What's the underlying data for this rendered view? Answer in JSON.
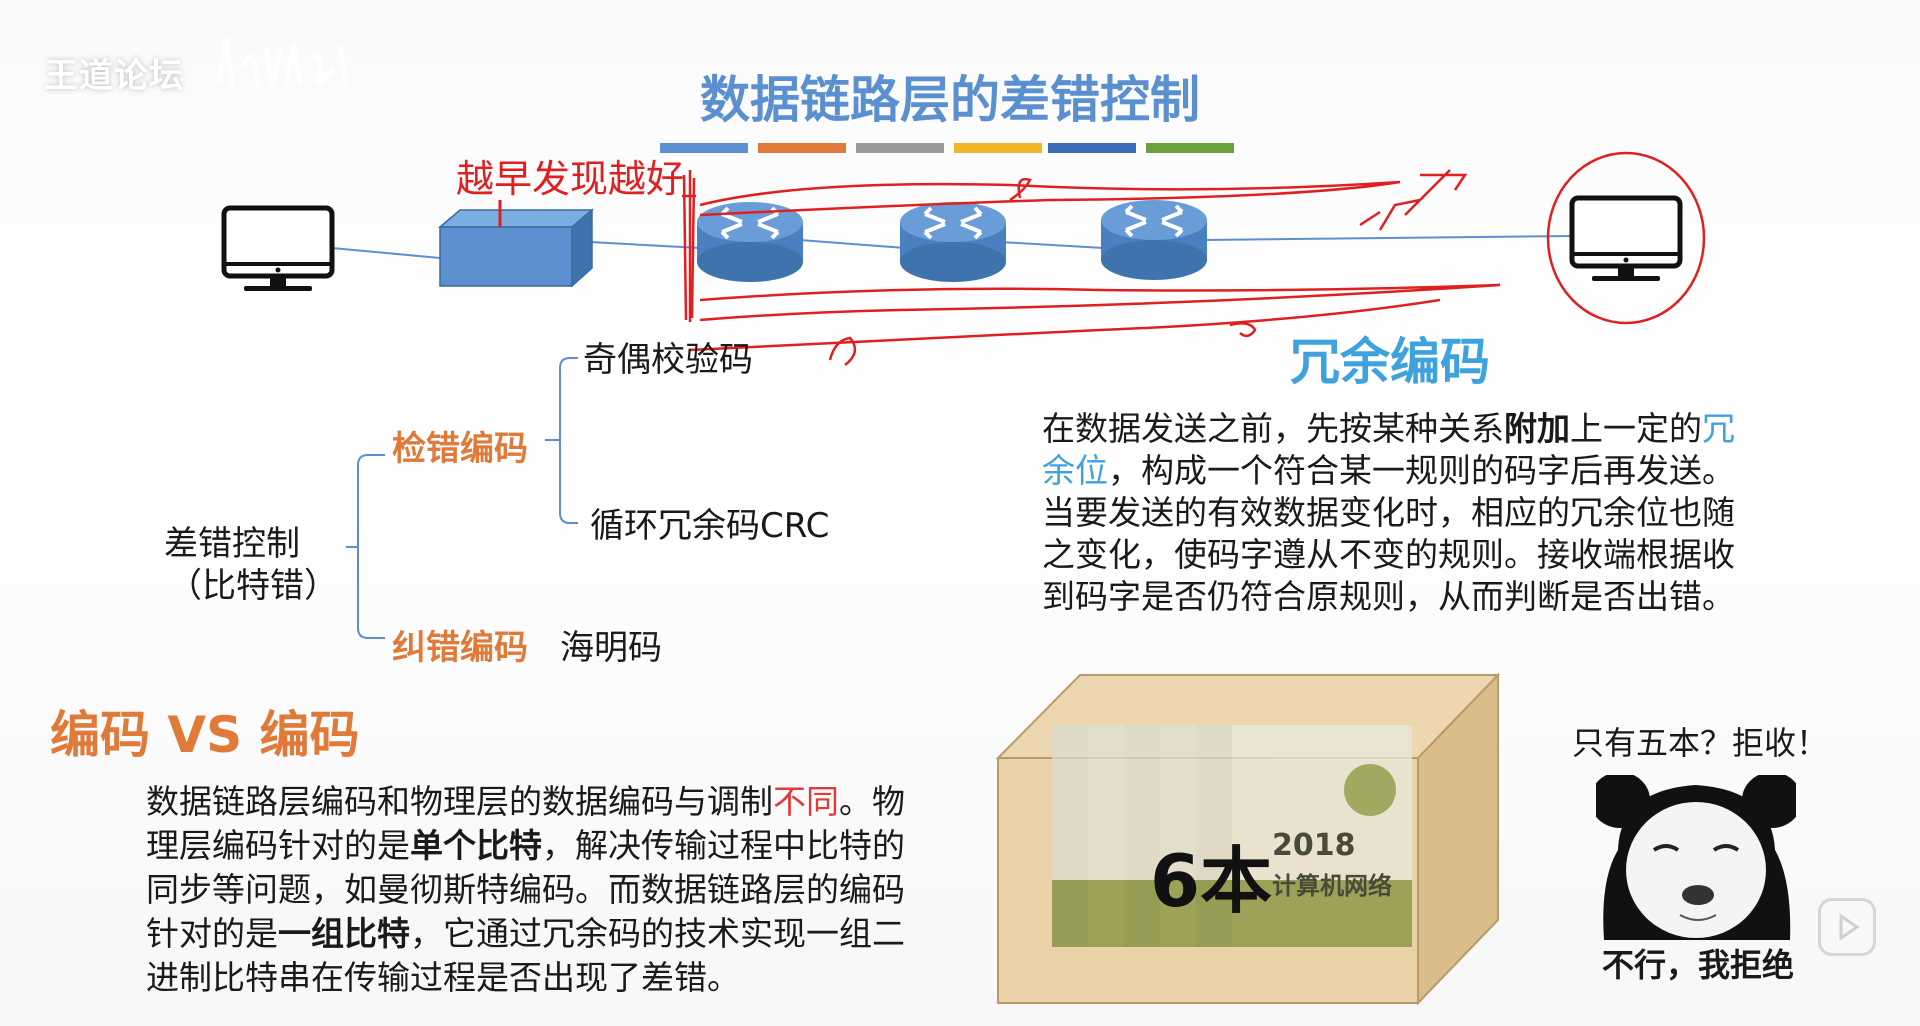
{
  "logo": {
    "text": "王道论坛"
  },
  "title": "数据链路层的差错控制",
  "handwritten_note": "越早发现越好",
  "tree": {
    "root_line1": "差错控制",
    "root_line2": "（比特错）",
    "detect": {
      "label": "检错编码",
      "children": [
        "奇偶校验码",
        "循环冗余码CRC"
      ]
    },
    "correct": {
      "label": "纠错编码",
      "child": "海明码"
    }
  },
  "redundant": {
    "title": "冗余编码",
    "p1_a": "在数据发送之前，先按某种关系",
    "p1_bold": "附加",
    "p1_b": "上一定的",
    "p1_cyan1": "冗",
    "p1_cyan2": "余位",
    "p1_c": "，构成一个符合某一规则的码字后再发送。",
    "line3": "当要发送的有效数据变化时，相应的冗余位也随",
    "line4": "之变化，使码字遵从不变的规则。接收端根据收",
    "line5": "到码字是否仍符合原规则，从而判断是否出错。"
  },
  "vs": {
    "title": "编码 VS 编码",
    "l1a": "数据链路层编码和物理层的数据编码与调制",
    "l1red": "不同",
    "l1b": "。物",
    "l2a": "理层编码针对的是",
    "l2bold": "单个比特",
    "l2b": "，解决传输过程中比特的",
    "l3": "同步等问题，如曼彻斯特编码。而数据链路层的编码",
    "l4a": "针对的是",
    "l4bold": "一组比特",
    "l4b": "，它通过冗余码的技术实现一组二",
    "l5": "进制比特串在传输过程是否出现了差错。"
  },
  "box": {
    "count": "6本",
    "book_year": "2018",
    "book_title": "计算机网络"
  },
  "meme": {
    "top": "只有五本？拒收！",
    "bottom": "不行，我拒绝"
  },
  "colors": {
    "bars": [
      "#5b8fd0",
      "#e07a38",
      "#9a9a9a",
      "#f3b527",
      "#3f6cb9",
      "#6aa13d"
    ],
    "title_blue": "#5a8fd0",
    "orange": "#e07a38",
    "cyan": "#3ea2de",
    "red_ink": "#e02020"
  }
}
